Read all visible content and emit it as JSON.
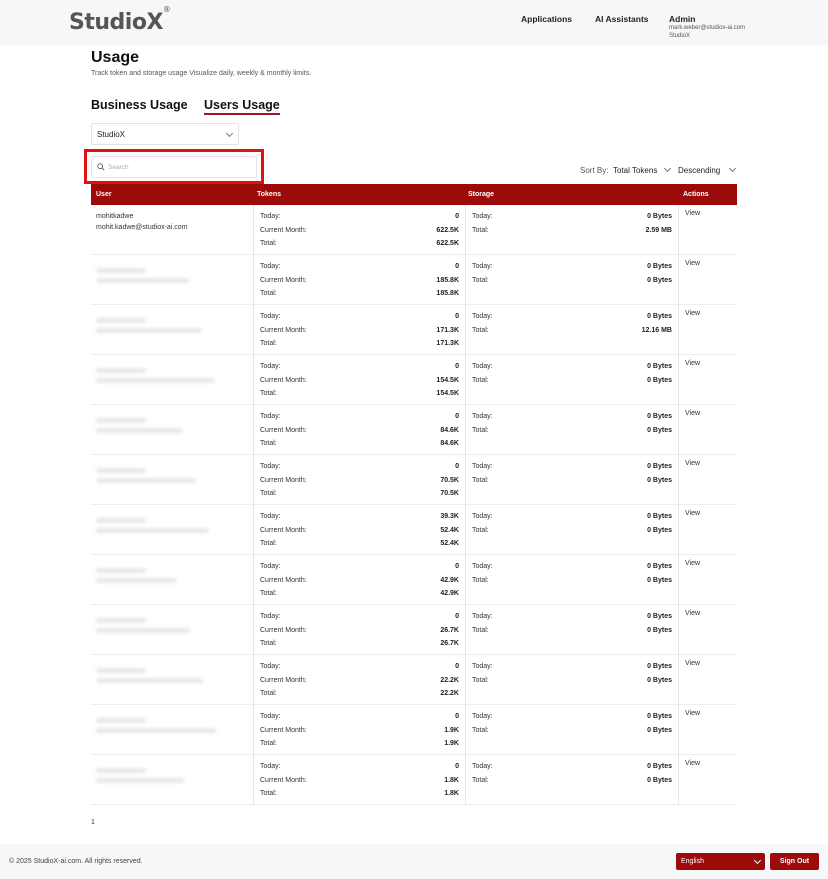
{
  "brand": {
    "name": "Studio",
    "x": "X",
    "mark": "®"
  },
  "nav": {
    "applications": "Applications",
    "assistants": "AI Assistants"
  },
  "admin": {
    "name": "Admin",
    "email": "mark.weber@studiox-ai.com",
    "org": "StudioX"
  },
  "page": {
    "title": "Usage",
    "subtitle": "Track token and storage usage Visualize daily, weekly & monthly limits."
  },
  "tabs": {
    "business": "Business Usage",
    "users": "Users Usage"
  },
  "org_select": {
    "value": "StudioX"
  },
  "search": {
    "placeholder": "Search"
  },
  "sort": {
    "label": "Sort By:",
    "field": "Total Tokens",
    "direction": "Descending"
  },
  "table": {
    "headers": {
      "user": "User",
      "tokens": "Tokens",
      "storage": "Storage",
      "actions": "Actions"
    },
    "labels": {
      "today": "Today:",
      "month": "Current Month:",
      "total": "Total:"
    },
    "view_label": "View",
    "first_user": {
      "name": "mohitkadwe",
      "email": "mohit.kadwe@studiox-ai.com"
    },
    "rows": [
      {
        "tok_today": "0",
        "tok_month": "622.5K",
        "tok_total": "622.5K",
        "sto_today": "0 Bytes",
        "sto_total": "2.59 MB"
      },
      {
        "tok_today": "0",
        "tok_month": "185.8K",
        "tok_total": "185.8K",
        "sto_today": "0 Bytes",
        "sto_total": "0 Bytes"
      },
      {
        "tok_today": "0",
        "tok_month": "171.3K",
        "tok_total": "171.3K",
        "sto_today": "0 Bytes",
        "sto_total": "12.16 MB"
      },
      {
        "tok_today": "0",
        "tok_month": "154.5K",
        "tok_total": "154.5K",
        "sto_today": "0 Bytes",
        "sto_total": "0 Bytes"
      },
      {
        "tok_today": "0",
        "tok_month": "84.6K",
        "tok_total": "84.6K",
        "sto_today": "0 Bytes",
        "sto_total": "0 Bytes"
      },
      {
        "tok_today": "0",
        "tok_month": "70.5K",
        "tok_total": "70.5K",
        "sto_today": "0 Bytes",
        "sto_total": "0 Bytes"
      },
      {
        "tok_today": "39.3K",
        "tok_month": "52.4K",
        "tok_total": "52.4K",
        "sto_today": "0 Bytes",
        "sto_total": "0 Bytes"
      },
      {
        "tok_today": "0",
        "tok_month": "42.9K",
        "tok_total": "42.9K",
        "sto_today": "0 Bytes",
        "sto_total": "0 Bytes"
      },
      {
        "tok_today": "0",
        "tok_month": "26.7K",
        "tok_total": "26.7K",
        "sto_today": "0 Bytes",
        "sto_total": "0 Bytes"
      },
      {
        "tok_today": "0",
        "tok_month": "22.2K",
        "tok_total": "22.2K",
        "sto_today": "0 Bytes",
        "sto_total": "0 Bytes"
      },
      {
        "tok_today": "0",
        "tok_month": "1.9K",
        "tok_total": "1.9K",
        "sto_today": "0 Bytes",
        "sto_total": "0 Bytes"
      },
      {
        "tok_today": "0",
        "tok_month": "1.8K",
        "tok_total": "1.8K",
        "sto_today": "0 Bytes",
        "sto_total": "0 Bytes"
      }
    ]
  },
  "pagination": {
    "page": "1"
  },
  "footer": {
    "copyright": "© 2025 StudioX-ai.com.  All rights reserved.",
    "language": "English",
    "signout": "Sign Out"
  },
  "colors": {
    "accent": "#9c0a0a",
    "highlight": "#e01111"
  }
}
